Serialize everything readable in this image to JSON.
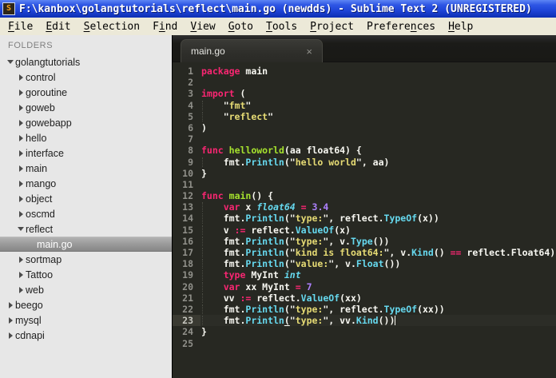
{
  "window": {
    "title": "F:\\kanbox\\golangtutorials\\reflect\\main.go (newdds) - Sublime Text 2 (UNREGISTERED)",
    "app_icon_glyph": "S"
  },
  "menu_bar": {
    "items": [
      {
        "label": "File",
        "mnemonic_index": 0
      },
      {
        "label": "Edit",
        "mnemonic_index": 0
      },
      {
        "label": "Selection",
        "mnemonic_index": 0
      },
      {
        "label": "Find",
        "mnemonic_index": 1
      },
      {
        "label": "View",
        "mnemonic_index": 0
      },
      {
        "label": "Goto",
        "mnemonic_index": 0
      },
      {
        "label": "Tools",
        "mnemonic_index": 0
      },
      {
        "label": "Project",
        "mnemonic_index": 0
      },
      {
        "label": "Preferences",
        "mnemonic_index": 7
      },
      {
        "label": "Help",
        "mnemonic_index": 0
      }
    ]
  },
  "sidebar": {
    "header": "FOLDERS",
    "items": [
      {
        "label": "golangtutorials",
        "level": 0,
        "state": "expanded",
        "selected": false
      },
      {
        "label": "control",
        "level": 1,
        "state": "collapsed",
        "selected": false
      },
      {
        "label": "goroutine",
        "level": 1,
        "state": "collapsed",
        "selected": false
      },
      {
        "label": "goweb",
        "level": 1,
        "state": "collapsed",
        "selected": false
      },
      {
        "label": "gowebapp",
        "level": 1,
        "state": "collapsed",
        "selected": false
      },
      {
        "label": "hello",
        "level": 1,
        "state": "collapsed",
        "selected": false
      },
      {
        "label": "interface",
        "level": 1,
        "state": "collapsed",
        "selected": false
      },
      {
        "label": "main",
        "level": 1,
        "state": "collapsed",
        "selected": false
      },
      {
        "label": "mango",
        "level": 1,
        "state": "collapsed",
        "selected": false
      },
      {
        "label": "object",
        "level": 1,
        "state": "collapsed",
        "selected": false
      },
      {
        "label": "oscmd",
        "level": 1,
        "state": "collapsed",
        "selected": false
      },
      {
        "label": "reflect",
        "level": 1,
        "state": "expanded",
        "selected": false
      },
      {
        "label": "main.go",
        "level": 2,
        "state": "file",
        "selected": true
      },
      {
        "label": "sortmap",
        "level": 1,
        "state": "collapsed",
        "selected": false
      },
      {
        "label": "Tattoo",
        "level": 1,
        "state": "collapsed",
        "selected": false
      },
      {
        "label": "web",
        "level": 1,
        "state": "collapsed",
        "selected": false
      },
      {
        "label": "beego",
        "level": 0,
        "state": "collapsed",
        "selected": false
      },
      {
        "label": "mysql",
        "level": 0,
        "state": "collapsed",
        "selected": false
      },
      {
        "label": "cdnapi",
        "level": 0,
        "state": "collapsed",
        "selected": false
      }
    ]
  },
  "tab_bar": {
    "tabs": [
      {
        "label": "main.go",
        "active": true,
        "close_glyph": "×"
      }
    ]
  },
  "theme": {
    "editor_bg": "#272822",
    "foreground": "#F8F8F2",
    "keyword": "#F92672",
    "function_def": "#A6E22E",
    "function_call": "#66D9EF",
    "type_italic": "#66D9EF",
    "string": "#E6DB74",
    "number": "#AE81FF",
    "line_number": "#90908A",
    "sidebar_bg": "#E7E7E7",
    "titlebar_blue": "#1D43D6"
  },
  "editor": {
    "language": "Go",
    "active_line": 23,
    "total_lines": 25,
    "lines": [
      {
        "n": 1,
        "t": [
          [
            "k",
            "package"
          ],
          [
            "p",
            " main"
          ]
        ]
      },
      {
        "n": 2,
        "t": []
      },
      {
        "n": 3,
        "t": [
          [
            "k",
            "import"
          ],
          [
            "p",
            " ("
          ]
        ]
      },
      {
        "n": 4,
        "t": [
          [
            "p",
            "    \""
          ],
          [
            "s",
            "fmt"
          ],
          [
            "p",
            "\""
          ]
        ]
      },
      {
        "n": 5,
        "t": [
          [
            "p",
            "    \""
          ],
          [
            "s",
            "reflect"
          ],
          [
            "p",
            "\""
          ]
        ]
      },
      {
        "n": 6,
        "t": [
          [
            "p",
            ")"
          ]
        ]
      },
      {
        "n": 7,
        "t": []
      },
      {
        "n": 8,
        "t": [
          [
            "k",
            "func"
          ],
          [
            "p",
            " "
          ],
          [
            "f",
            "helloworld"
          ],
          [
            "p",
            "(aa float64) {"
          ]
        ]
      },
      {
        "n": 9,
        "t": [
          [
            "p",
            "    fmt."
          ],
          [
            "c",
            "Println"
          ],
          [
            "p",
            "(\""
          ],
          [
            "s",
            "hello world"
          ],
          [
            "p",
            "\", aa)"
          ]
        ]
      },
      {
        "n": 10,
        "t": [
          [
            "p",
            "}"
          ]
        ]
      },
      {
        "n": 11,
        "t": []
      },
      {
        "n": 12,
        "t": [
          [
            "k",
            "func"
          ],
          [
            "p",
            " "
          ],
          [
            "f",
            "main"
          ],
          [
            "p",
            "() {"
          ]
        ]
      },
      {
        "n": 13,
        "t": [
          [
            "p",
            "    "
          ],
          [
            "k",
            "var"
          ],
          [
            "p",
            " x "
          ],
          [
            "t",
            "float64"
          ],
          [
            "p",
            " "
          ],
          [
            "k",
            "="
          ],
          [
            "p",
            " "
          ],
          [
            "n",
            "3.4"
          ]
        ]
      },
      {
        "n": 14,
        "t": [
          [
            "p",
            "    fmt."
          ],
          [
            "c",
            "Println"
          ],
          [
            "p",
            "(\""
          ],
          [
            "s",
            "type:"
          ],
          [
            "p",
            "\", reflect."
          ],
          [
            "c",
            "TypeOf"
          ],
          [
            "p",
            "(x))"
          ]
        ]
      },
      {
        "n": 15,
        "t": [
          [
            "p",
            "    v "
          ],
          [
            "k",
            ":="
          ],
          [
            "p",
            " reflect."
          ],
          [
            "c",
            "ValueOf"
          ],
          [
            "p",
            "(x)"
          ]
        ]
      },
      {
        "n": 16,
        "t": [
          [
            "p",
            "    fmt."
          ],
          [
            "c",
            "Println"
          ],
          [
            "p",
            "(\""
          ],
          [
            "s",
            "type:"
          ],
          [
            "p",
            "\", v."
          ],
          [
            "c",
            "Type"
          ],
          [
            "p",
            "())"
          ]
        ]
      },
      {
        "n": 17,
        "t": [
          [
            "p",
            "    fmt."
          ],
          [
            "c",
            "Println"
          ],
          [
            "p",
            "(\""
          ],
          [
            "s",
            "kind is float64:"
          ],
          [
            "p",
            "\", v."
          ],
          [
            "c",
            "Kind"
          ],
          [
            "p",
            "() "
          ],
          [
            "k",
            "=="
          ],
          [
            "p",
            " reflect.Float64)"
          ]
        ]
      },
      {
        "n": 18,
        "t": [
          [
            "p",
            "    fmt."
          ],
          [
            "c",
            "Println"
          ],
          [
            "p",
            "(\""
          ],
          [
            "s",
            "value:"
          ],
          [
            "p",
            "\", v."
          ],
          [
            "c",
            "Float"
          ],
          [
            "p",
            "())"
          ]
        ]
      },
      {
        "n": 19,
        "t": [
          [
            "p",
            "    "
          ],
          [
            "k",
            "type"
          ],
          [
            "p",
            " MyInt "
          ],
          [
            "t",
            "int"
          ]
        ]
      },
      {
        "n": 20,
        "t": [
          [
            "p",
            "    "
          ],
          [
            "k",
            "var"
          ],
          [
            "p",
            " xx MyInt "
          ],
          [
            "k",
            "="
          ],
          [
            "p",
            " "
          ],
          [
            "n",
            "7"
          ]
        ]
      },
      {
        "n": 21,
        "t": [
          [
            "p",
            "    vv "
          ],
          [
            "k",
            ":="
          ],
          [
            "p",
            " reflect."
          ],
          [
            "c",
            "ValueOf"
          ],
          [
            "p",
            "(xx)"
          ]
        ]
      },
      {
        "n": 22,
        "t": [
          [
            "p",
            "    fmt."
          ],
          [
            "c",
            "Println"
          ],
          [
            "p",
            "(\""
          ],
          [
            "s",
            "type:"
          ],
          [
            "p",
            "\", reflect."
          ],
          [
            "c",
            "TypeOf"
          ],
          [
            "p",
            "(xx))"
          ]
        ]
      },
      {
        "n": 23,
        "t": [
          [
            "p",
            "    fmt."
          ],
          [
            "c",
            "Println"
          ],
          [
            "b",
            "("
          ],
          [
            "p",
            "\""
          ],
          [
            "s",
            "type:"
          ],
          [
            "p",
            "\", vv."
          ],
          [
            "c",
            "Kind"
          ],
          [
            "p",
            "())"
          ],
          [
            "caret",
            ""
          ]
        ]
      },
      {
        "n": 24,
        "t": [
          [
            "p",
            "}"
          ]
        ]
      },
      {
        "n": 25,
        "t": []
      }
    ]
  }
}
